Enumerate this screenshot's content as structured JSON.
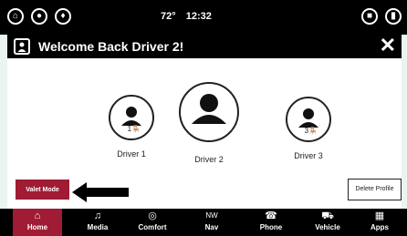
{
  "status_bar": {
    "temperature": "72°",
    "time": "12:32",
    "left_icons": [
      "home-icon",
      "user-icon",
      "bell-icon"
    ],
    "right_icons": [
      "camera-icon",
      "phone-icon"
    ]
  },
  "header": {
    "title": "Welcome Back Driver 2!"
  },
  "drivers": [
    {
      "label": "Driver 1",
      "seat": "1"
    },
    {
      "label": "Driver 2",
      "seat": ""
    },
    {
      "label": "Driver 3",
      "seat": "3"
    }
  ],
  "buttons": {
    "valet": "Valet Mode",
    "delete_profile": "Delete Profile"
  },
  "nav": [
    {
      "label": "Home",
      "icon": "⌂",
      "active": true
    },
    {
      "label": "Media",
      "icon": "♫",
      "active": false
    },
    {
      "label": "Comfort",
      "icon": "◎",
      "active": false
    },
    {
      "label": "Nav",
      "icon": "NW",
      "active": false
    },
    {
      "label": "Phone",
      "icon": "☎",
      "active": false
    },
    {
      "label": "Vehicle",
      "icon": "⛟",
      "active": false
    },
    {
      "label": "Apps",
      "icon": "▦",
      "active": false
    }
  ],
  "colors": {
    "accent": "#a01b34",
    "frame": "#e9f4f3",
    "bar": "#000000"
  }
}
